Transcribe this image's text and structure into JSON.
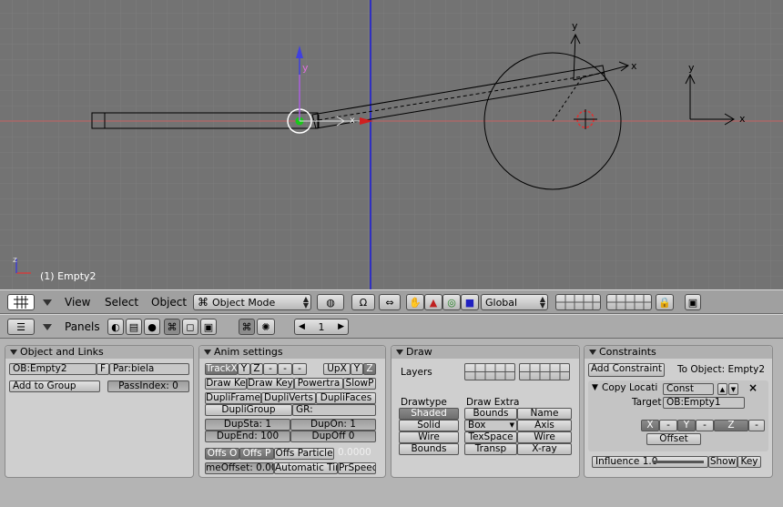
{
  "viewport": {
    "active_object_label": "(1) Empty2"
  },
  "header1": {
    "menus": [
      "View",
      "Select",
      "Object"
    ],
    "mode": "Object Mode",
    "orientation": "Global"
  },
  "header2": {
    "panels_label": "Panels",
    "frame": "1"
  },
  "object_links": {
    "title": "Object and Links",
    "ob_name": "OB:Empty2",
    "f_label": "F",
    "parent": "Par:biela",
    "add_group": "Add to Group",
    "pass_index": "PassIndex: 0"
  },
  "anim": {
    "title": "Anim settings",
    "track": [
      "TrackX",
      "Y",
      "Z",
      "-",
      "-",
      "-"
    ],
    "up": [
      "UpX",
      "Y",
      "Z"
    ],
    "draw_key": "Draw Ke",
    "draw_key_sel": "Draw Key",
    "powertrack": "Powertra",
    "slowpar": "SlowP",
    "dupliframes": "DupliFrames",
    "dupliverts": "DupliVerts",
    "duplifaces": "DupliFaces",
    "dupligroup": "DupliGroup",
    "gr": "GR:",
    "dupsta": "DupSta: 1",
    "dupon": "DupOn: 1",
    "dupend": "DupEnd: 100",
    "dupoff": "DupOff 0",
    "offs_ob": "Offs O",
    "offs_par": "Offs P",
    "offs_particle": "Offs Particle",
    "offset_value": "0.0000",
    "time_offset": "meOffset: 0.00",
    "auto_time": "Automatic Tim",
    "prspeed": "PrSpeed"
  },
  "draw": {
    "title": "Draw",
    "layers_label": "Layers",
    "drawtype_label": "Drawtype",
    "drawtypes": [
      "Shaded",
      "Solid",
      "Wire",
      "Bounds"
    ],
    "extra_label": "Draw Extra",
    "bounds": "Bounds",
    "box": "Box",
    "texspace": "TexSpace",
    "transp": "Transp",
    "name": "Name",
    "axis": "Axis",
    "wire": "Wire",
    "xray": "X-ray"
  },
  "constraints": {
    "title": "Constraints",
    "add": "Add Constraint",
    "to_object": "To Object: Empty2",
    "copy_loc": "Copy Locati",
    "const": "Const",
    "target_label": "Target",
    "target": "OB:Empty1",
    "axes": [
      "X",
      "-",
      "Y",
      "-",
      "Z",
      "-"
    ],
    "offset": "Offset",
    "influence": "Influence 1.0",
    "show": "Show",
    "key": "Key",
    "close": "×"
  },
  "colors": {
    "viewport_bg": "#737373",
    "x_axis": "#c83c3c",
    "z_axis": "#2828c8",
    "selected": "#ffffff",
    "highlight": "#646464"
  }
}
